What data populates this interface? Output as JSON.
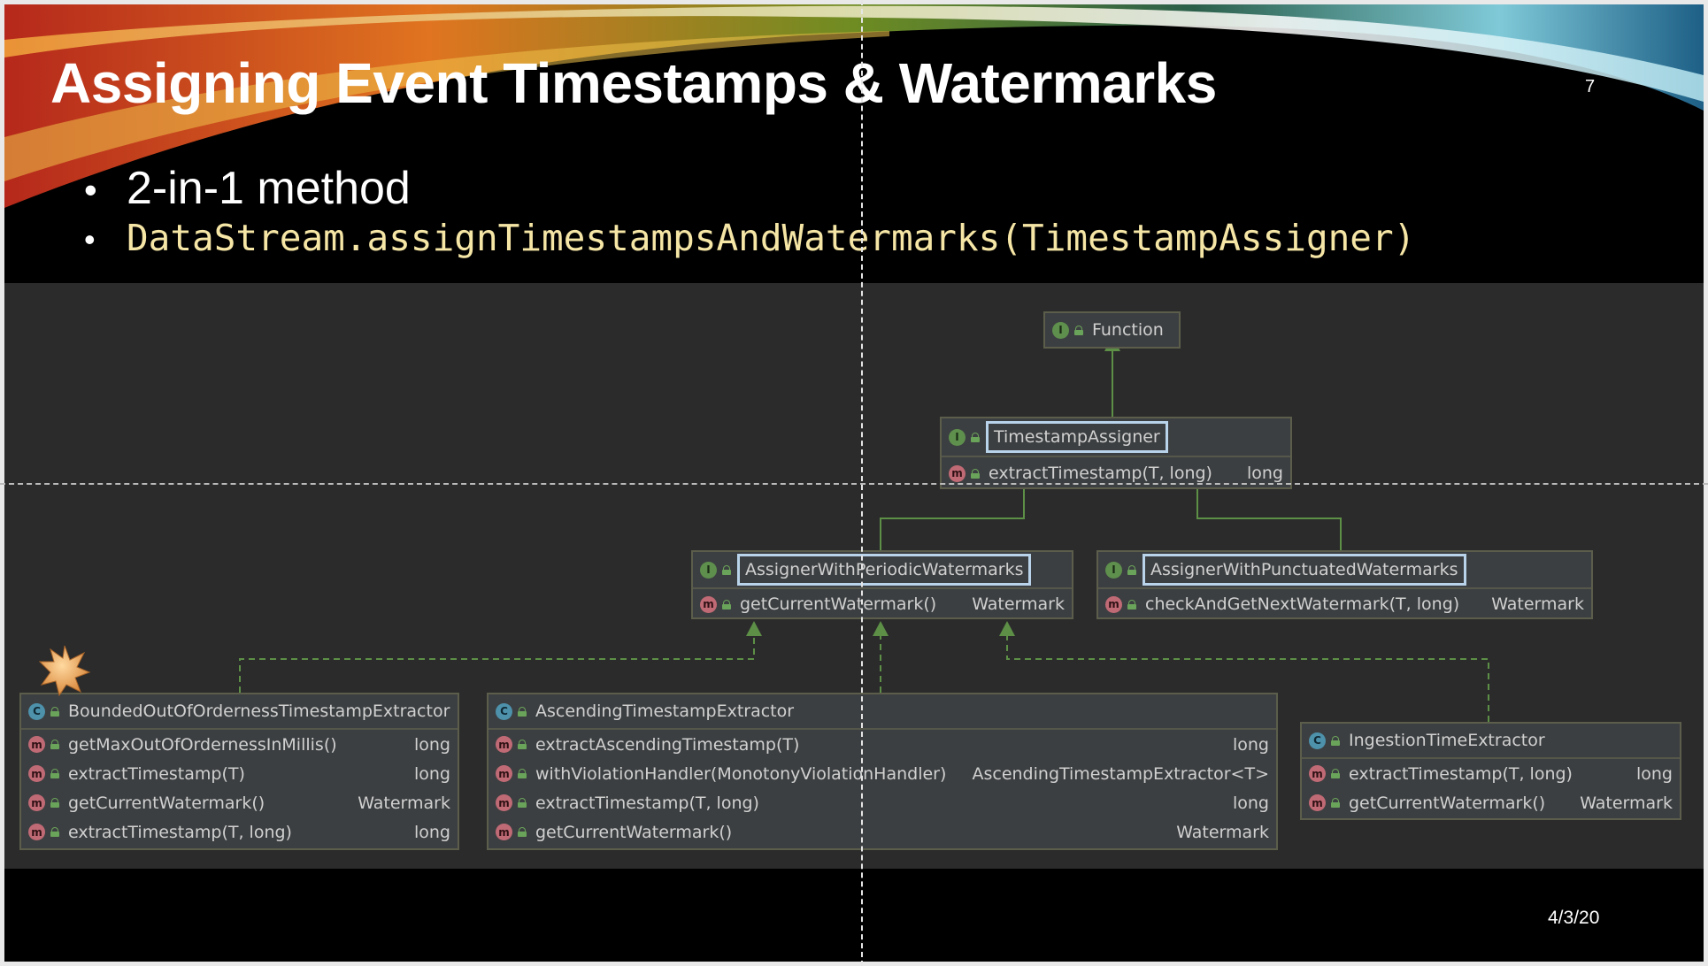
{
  "slide": {
    "title": "Assigning Event Timestamps & Watermarks",
    "slide_number": "7",
    "bullets": [
      "2-in-1 method",
      "DataStream.assignTimestampsAndWatermarks(TimestampAssigner)"
    ],
    "date": "4/3/20"
  },
  "diagram": {
    "function": {
      "badge": "I",
      "name": "Function"
    },
    "timestamp_assigner": {
      "badge": "I",
      "name": "TimestampAssigner",
      "methods": [
        {
          "badge": "m",
          "name": "extractTimestamp(T, long)",
          "type": "long"
        }
      ]
    },
    "periodic": {
      "badge": "I",
      "name": "AssignerWithPeriodicWatermarks",
      "methods": [
        {
          "badge": "m",
          "name": "getCurrentWatermark()",
          "type": "Watermark"
        }
      ]
    },
    "punctuated": {
      "badge": "I",
      "name": "AssignerWithPunctuatedWatermarks",
      "methods": [
        {
          "badge": "m",
          "name": "checkAndGetNextWatermark(T, long)",
          "type": "Watermark"
        }
      ]
    },
    "bounded": {
      "badge": "C",
      "name": "BoundedOutOfOrdernessTimestampExtractor",
      "methods": [
        {
          "badge": "m",
          "name": "getMaxOutOfOrdernessInMillis()",
          "type": "long"
        },
        {
          "badge": "m",
          "name": "extractTimestamp(T)",
          "type": "long"
        },
        {
          "badge": "m",
          "name": "getCurrentWatermark()",
          "type": "Watermark"
        },
        {
          "badge": "m",
          "name": "extractTimestamp(T, long)",
          "type": "long"
        }
      ]
    },
    "ascending": {
      "badge": "C",
      "name": "AscendingTimestampExtractor",
      "methods": [
        {
          "badge": "m",
          "name": "extractAscendingTimestamp(T)",
          "type": "long"
        },
        {
          "badge": "m",
          "name": "withViolationHandler(MonotonyViolationHandler)",
          "type": "AscendingTimestampExtractor<T>"
        },
        {
          "badge": "m",
          "name": "extractTimestamp(T, long)",
          "type": "long"
        },
        {
          "badge": "m",
          "name": "getCurrentWatermark()",
          "type": "Watermark"
        }
      ]
    },
    "ingestion": {
      "badge": "C",
      "name": "IngestionTimeExtractor",
      "methods": [
        {
          "badge": "m",
          "name": "extractTimestamp(T, long)",
          "type": "long"
        },
        {
          "badge": "m",
          "name": "getCurrentWatermark()",
          "type": "Watermark"
        }
      ]
    }
  },
  "colors": {
    "slide_bg": "#000000",
    "diagram_bg": "#2b2b2b",
    "node_bg": "#3c3f41",
    "edge": "#5d8f47",
    "code_text": "#f6e6a6",
    "highlight": "#b8d3ea"
  }
}
